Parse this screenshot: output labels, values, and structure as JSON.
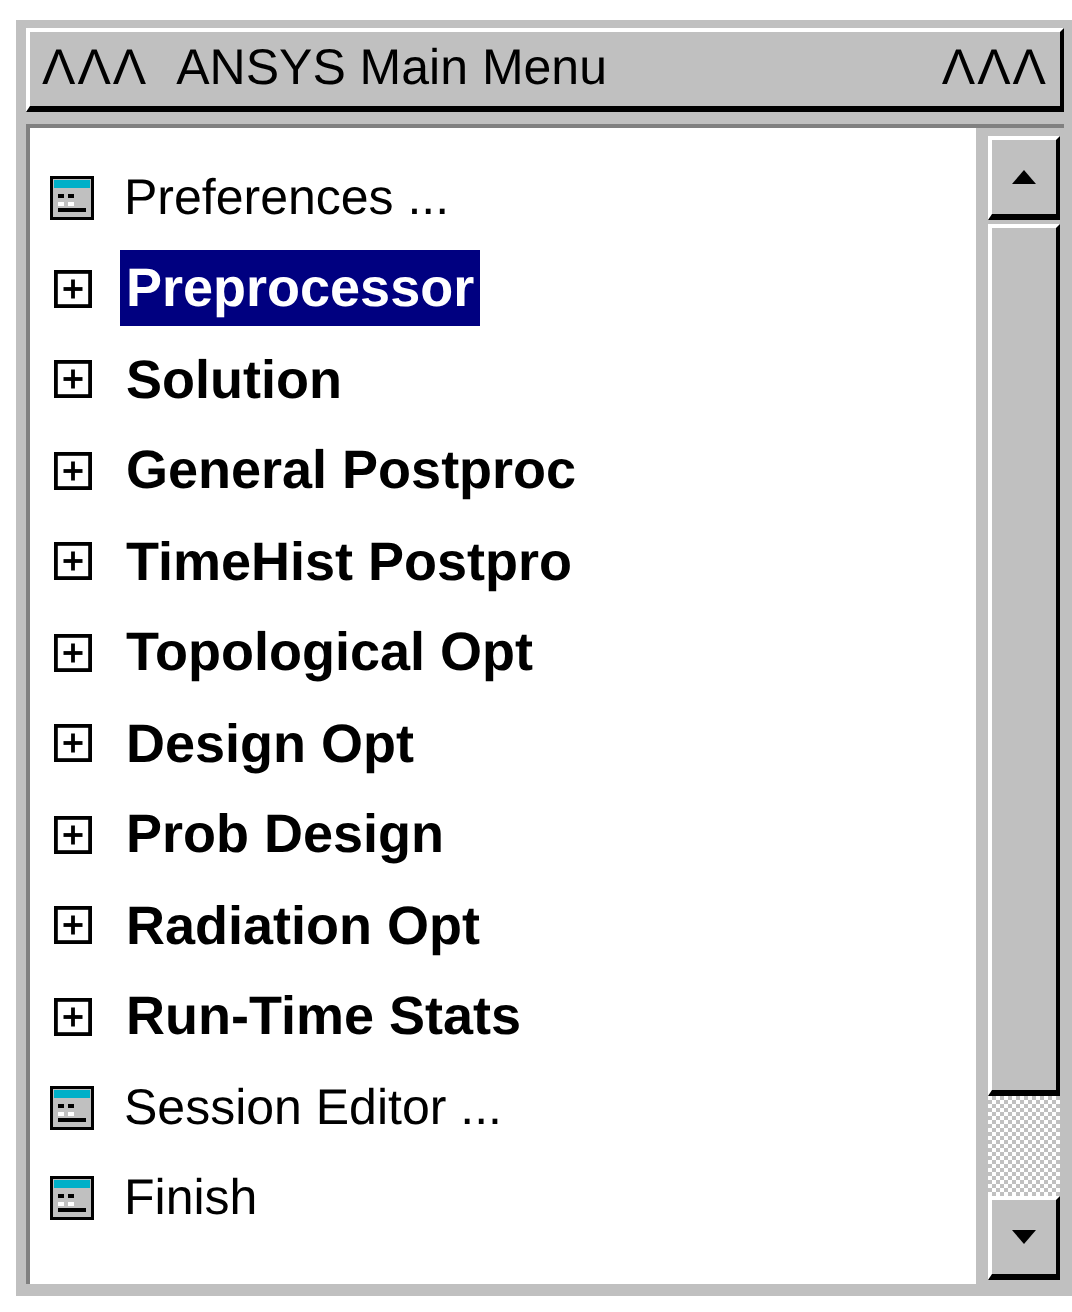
{
  "window": {
    "title": "ANSYS Main Menu",
    "title_marks_left": "ΛΛΛ",
    "title_marks_right": "ΛΛΛ"
  },
  "menu": {
    "items": [
      {
        "label": "Preferences ...",
        "kind": "dialog",
        "selected": false
      },
      {
        "label": "Preprocessor",
        "kind": "submenu",
        "selected": true
      },
      {
        "label": "Solution",
        "kind": "submenu",
        "selected": false
      },
      {
        "label": "General Postproc",
        "kind": "submenu",
        "selected": false
      },
      {
        "label": "TimeHist Postpro",
        "kind": "submenu",
        "selected": false
      },
      {
        "label": "Topological Opt",
        "kind": "submenu",
        "selected": false
      },
      {
        "label": "Design Opt",
        "kind": "submenu",
        "selected": false
      },
      {
        "label": "Prob Design",
        "kind": "submenu",
        "selected": false
      },
      {
        "label": "Radiation Opt",
        "kind": "submenu",
        "selected": false
      },
      {
        "label": "Run-Time Stats",
        "kind": "submenu",
        "selected": false
      },
      {
        "label": "Session Editor ...",
        "kind": "dialog",
        "selected": false
      },
      {
        "label": "Finish",
        "kind": "dialog",
        "selected": false
      }
    ]
  }
}
